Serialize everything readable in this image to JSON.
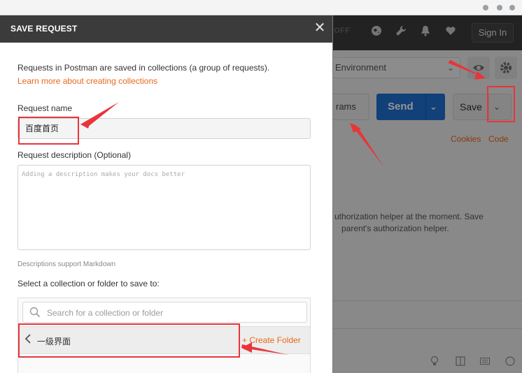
{
  "app": {
    "sync_label": "OFF",
    "signin_label": "Sign In",
    "environment": "Environment",
    "params_label": "rams",
    "send_label": "Send",
    "save_label": "Save",
    "cookies_label": "Cookies",
    "code_label": "Code",
    "auth_text_1": "uthorization helper at the moment. Save",
    "auth_text_2": "parent's authorization helper."
  },
  "modal": {
    "title": "SAVE REQUEST",
    "close_glyph": "✕",
    "intro": "Requests in Postman are saved in collections (a group of requests).",
    "learn_more": "Learn more about creating collections",
    "name_label": "Request name",
    "name_value": "百度首页",
    "desc_label": "Request description (Optional)",
    "desc_placeholder": "Adding a description makes your docs better",
    "markdown_note": "Descriptions support Markdown",
    "collection_label": "Select a collection or folder to save to:",
    "search_placeholder": "Search for a collection or folder",
    "collection_name": "一级界面",
    "create_folder": "+ Create Folder"
  },
  "icons": {
    "globe": "globe-icon",
    "wrench": "wrench-icon",
    "bell": "bell-icon",
    "heart": "heart-icon",
    "eye": "eye-icon",
    "gear": "gear-icon",
    "search": "search-icon",
    "back": "chevron-left-icon",
    "close": "close-icon"
  },
  "colors": {
    "accent_orange": "#e8691b",
    "send_blue": "#1f6fd1",
    "header_dark": "#3b3b3b",
    "annotation_red": "#e8353a"
  }
}
